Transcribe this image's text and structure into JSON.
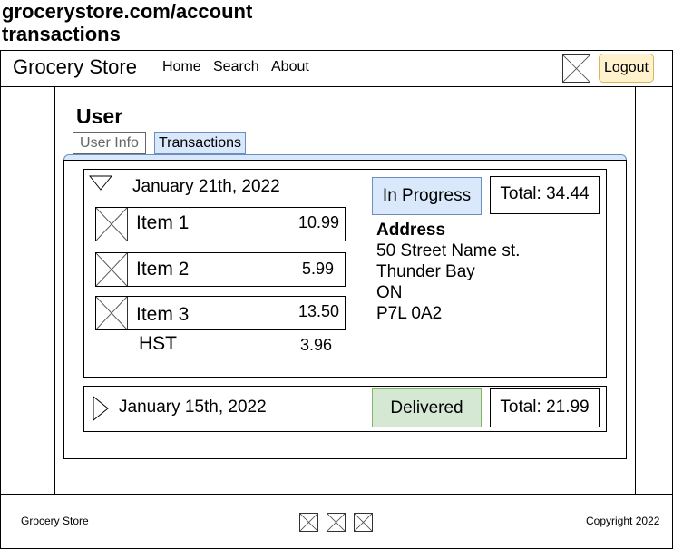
{
  "url": {
    "line1": "grocerystore.com/account",
    "line2": "transactions"
  },
  "header": {
    "brand": "Grocery Store",
    "nav": [
      {
        "label": "Home"
      },
      {
        "label": "Search"
      },
      {
        "label": "About"
      }
    ],
    "logout_label": "Logout"
  },
  "page": {
    "title": "User",
    "tabs": [
      {
        "label": "User Info",
        "active": false
      },
      {
        "label": "Transactions",
        "active": true
      }
    ]
  },
  "transactions": [
    {
      "date": "January 21th, 2022",
      "expanded": true,
      "status": "In Progress",
      "total": "Total: 34.44",
      "items": [
        {
          "name": "Item 1",
          "price": "10.99"
        },
        {
          "name": "Item 2",
          "price": "5.99"
        },
        {
          "name": "Item 3",
          "price": "13.50"
        }
      ],
      "tax": {
        "label": "HST",
        "value": "3.96"
      },
      "address": {
        "heading": "Address",
        "street": "50 Street Name st.",
        "city": "Thunder Bay",
        "province": "ON",
        "postal": "P7L 0A2"
      }
    },
    {
      "date": "January 15th, 2022",
      "expanded": false,
      "status": "Delivered",
      "total": "Total: 21.99"
    }
  ],
  "footer": {
    "brand": "Grocery Store",
    "copyright": "Copyright 2022"
  },
  "colors": {
    "logout_bg": "#fff2cc",
    "logout_border": "#d6b656",
    "tab_active_bg": "#dae8fc",
    "tab_active_border": "#6c8ebf",
    "status_progress_bg": "#dae8fc",
    "status_delivered_bg": "#d5e8d4",
    "status_delivered_border": "#82b366"
  }
}
